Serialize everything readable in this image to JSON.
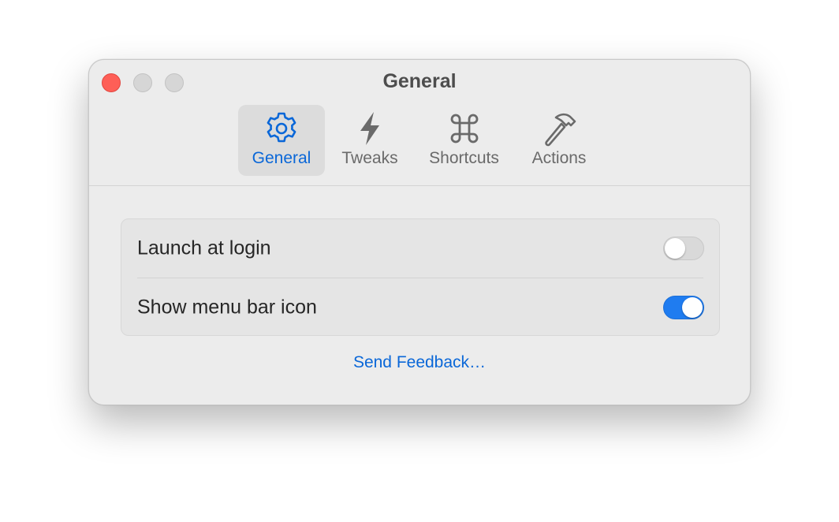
{
  "window": {
    "title": "General"
  },
  "tabs": [
    {
      "label": "General",
      "icon": "gear-icon",
      "active": true
    },
    {
      "label": "Tweaks",
      "icon": "bolt-icon",
      "active": false
    },
    {
      "label": "Shortcuts",
      "icon": "command-icon",
      "active": false
    },
    {
      "label": "Actions",
      "icon": "hammer-icon",
      "active": false
    }
  ],
  "settings": [
    {
      "label": "Launch at login",
      "enabled": false
    },
    {
      "label": "Show menu bar icon",
      "enabled": true
    }
  ],
  "feedback_link": "Send Feedback…",
  "colors": {
    "accent": "#0a67d8",
    "toggle_on": "#1f7cf0",
    "close_button": "#fe5f57",
    "window_bg": "#ececec"
  }
}
